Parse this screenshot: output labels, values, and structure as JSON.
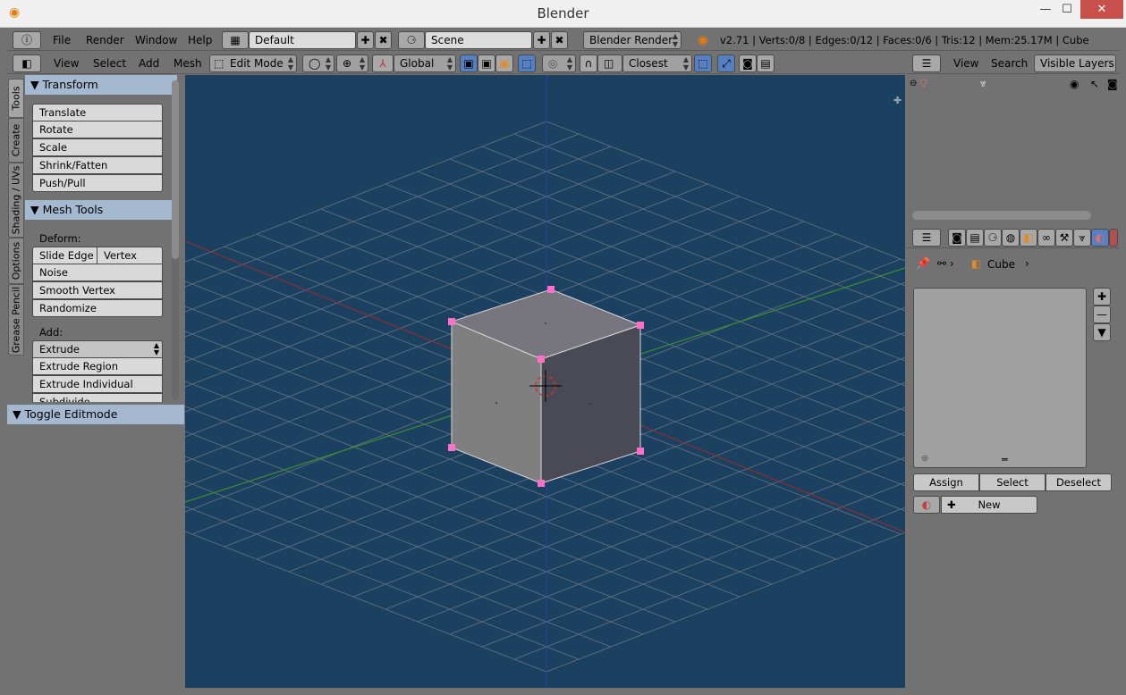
{
  "window": {
    "title": "Blender",
    "min": "—",
    "max": "☐",
    "close": "✕"
  },
  "info_header": {
    "menus": [
      "File",
      "Render",
      "Window",
      "Help"
    ],
    "screen_layout": "Default",
    "scene": "Scene",
    "render_engine": "Blender Render",
    "stats": "v2.71 | Verts:0/8 | Edges:0/12 | Faces:0/6 | Tris:12 | Mem:25.17M | Cube"
  },
  "view3d_header": {
    "menus": [
      "View",
      "Select",
      "Add",
      "Mesh"
    ],
    "mode": "Edit Mode",
    "orientation": "Global",
    "snap_target": "Closest"
  },
  "tool_tabs": [
    "Tools",
    "Create",
    "Shading / UVs",
    "Options",
    "Grease Pencil"
  ],
  "transform_panel": {
    "title": "Transform",
    "buttons": [
      "Translate",
      "Rotate",
      "Scale",
      "Shrink/Fatten",
      "Push/Pull"
    ]
  },
  "mesh_tools_panel": {
    "title": "Mesh Tools",
    "deform_label": "Deform:",
    "slide_edge": "Slide Edge",
    "vertex": "Vertex",
    "deform_buttons": [
      "Noise",
      "Smooth Vertex",
      "Randomize"
    ],
    "add_label": "Add:",
    "add_buttons": [
      "Extrude",
      "Extrude Region",
      "Extrude Individual",
      "Subdivide"
    ]
  },
  "toggle_panel": {
    "title": "Toggle Editmode"
  },
  "outliner_header": {
    "menus": [
      "View",
      "Search"
    ],
    "filter": "Visible Layers"
  },
  "properties": {
    "breadcrumb_object": "Cube",
    "assign": "Assign",
    "select": "Select",
    "deselect": "Deselect",
    "new": "New"
  },
  "colors": {
    "viewport_bg": "#1c4060",
    "vertex_select": "#ff6ec7",
    "panel_header": "#a4b8cf"
  }
}
